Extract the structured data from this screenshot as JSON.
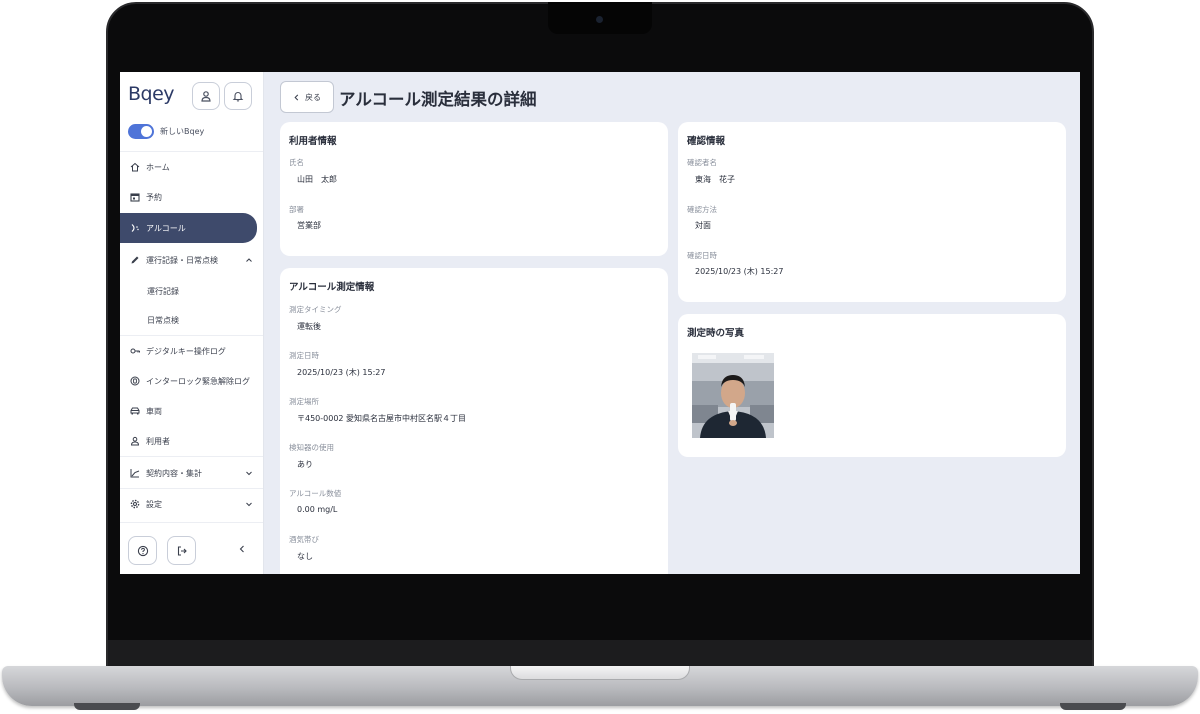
{
  "app": {
    "logo": "Bqey"
  },
  "sidebar": {
    "toggle_label": "新しいBqey",
    "toggle_on": true,
    "items": [
      {
        "label": "ホーム",
        "icon": "home-icon"
      },
      {
        "label": "予約",
        "icon": "calendar-icon"
      },
      {
        "label": "アルコール",
        "icon": "alcohol-icon",
        "active": true
      },
      {
        "label": "運行記録・日常点検",
        "icon": "pencil-icon",
        "expanded": true
      },
      {
        "label": "運行記録"
      },
      {
        "label": "日常点検"
      },
      {
        "label": "デジタルキー操作ログ",
        "icon": "key-icon"
      },
      {
        "label": "インターロック緊急解除ログ",
        "icon": "interlock-icon"
      },
      {
        "label": "車両",
        "icon": "car-icon"
      },
      {
        "label": "利用者",
        "icon": "user-icon"
      },
      {
        "label": "契約内容・集計",
        "icon": "chart-icon",
        "expanded": false
      },
      {
        "label": "設定",
        "icon": "gear-icon",
        "expanded": false
      }
    ]
  },
  "header": {
    "back_label": "戻る",
    "title": "アルコール測定結果の詳細"
  },
  "user_info": {
    "title": "利用者情報",
    "name_label": "氏名",
    "name_value": "山田　太郎",
    "dept_label": "部署",
    "dept_value": "営業部"
  },
  "measurement": {
    "title": "アルコール測定情報",
    "timing_label": "測定タイミング",
    "timing_value": "運転後",
    "datetime_label": "測定日時",
    "datetime_value": "2025/10/23 (木) 15:27",
    "place_label": "測定場所",
    "place_value": "〒450-0002 愛知県名古屋市中村区名駅４丁目",
    "detector_label": "検知器の使用",
    "detector_value": "あり",
    "level_label": "アルコール数値",
    "level_value": "0.00 mg/L",
    "drunk_label": "酒気帯び",
    "drunk_value": "なし"
  },
  "confirmation": {
    "title": "確認情報",
    "confirmer_label": "確認者名",
    "confirmer_value": "東海　花子",
    "method_label": "確認方法",
    "method_value": "対面",
    "datetime_label": "確認日時",
    "datetime_value": "2025/10/23 (木) 15:27"
  },
  "photo_card": {
    "title": "測定時の写真"
  },
  "colors": {
    "accent": "#4f74d8",
    "active_nav": "#3e4a6b",
    "background": "#e9ecf4"
  }
}
